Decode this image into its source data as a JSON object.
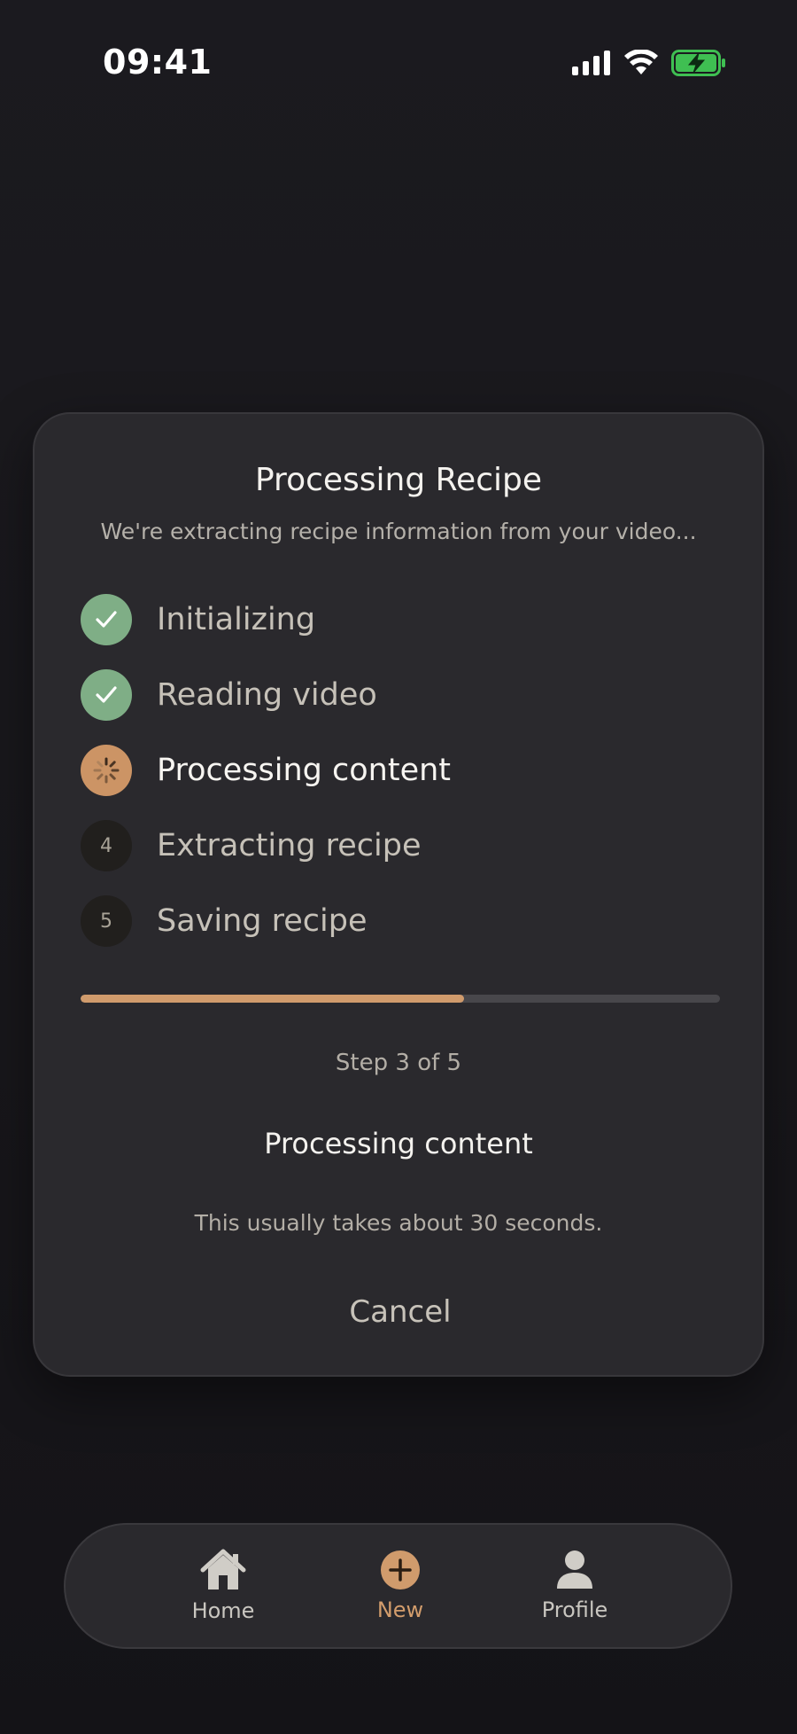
{
  "status_bar": {
    "time": "09:41"
  },
  "modal": {
    "title": "Processing Recipe",
    "subtitle": "We're extracting recipe information from your video...",
    "steps": [
      {
        "number": "1",
        "label": "Initializing",
        "state": "done"
      },
      {
        "number": "2",
        "label": "Reading video",
        "state": "done"
      },
      {
        "number": "3",
        "label": "Processing content",
        "state": "active"
      },
      {
        "number": "4",
        "label": "Extracting recipe",
        "state": "pending"
      },
      {
        "number": "5",
        "label": "Saving recipe",
        "state": "pending"
      }
    ],
    "progress_fraction": 0.6,
    "step_counter": "Step 3 of 5",
    "current_step": "Processing content",
    "eta": "This usually takes about 30 seconds.",
    "cancel_label": "Cancel"
  },
  "tab_bar": {
    "tabs": [
      {
        "label": "Home",
        "icon": "home-icon"
      },
      {
        "label": "New",
        "icon": "plus-circle-icon"
      },
      {
        "label": "Profile",
        "icon": "person-icon"
      }
    ]
  },
  "colors": {
    "background": "#18171c",
    "card": "#2a292d",
    "accent": "#d09b6c",
    "done_green": "#7fae86"
  }
}
